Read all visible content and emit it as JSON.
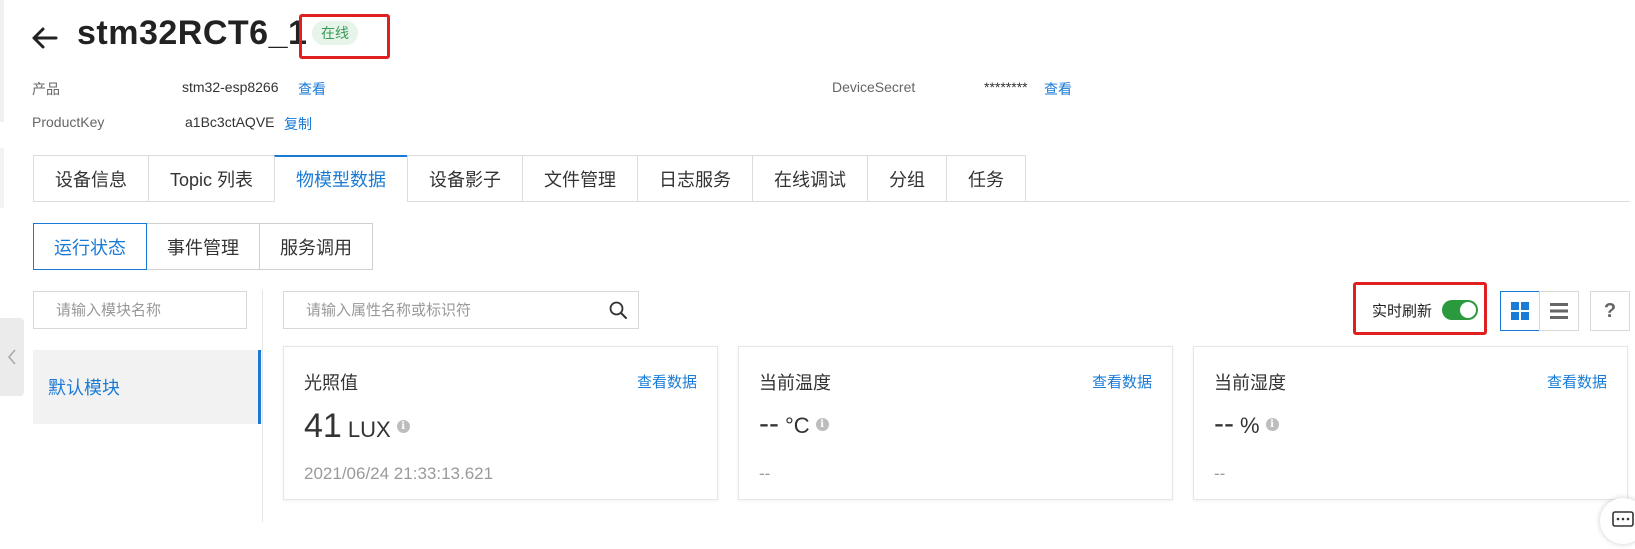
{
  "header": {
    "title": "stm32RCT6_1",
    "status": "在线"
  },
  "meta": {
    "product_label": "产品",
    "product_value": "stm32-esp8266",
    "product_link": "查看",
    "productkey_label": "ProductKey",
    "productkey_value": "a1Bc3ctAQVE",
    "productkey_link": "复制",
    "secret_label": "DeviceSecret",
    "secret_value": "********",
    "secret_link": "查看"
  },
  "main_tabs": [
    {
      "label": "设备信息"
    },
    {
      "label": "Topic 列表"
    },
    {
      "label": "物模型数据",
      "active": true
    },
    {
      "label": "设备影子"
    },
    {
      "label": "文件管理"
    },
    {
      "label": "日志服务"
    },
    {
      "label": "在线调试"
    },
    {
      "label": "分组"
    },
    {
      "label": "任务"
    }
  ],
  "sub_tabs": [
    {
      "label": "运行状态",
      "active": true
    },
    {
      "label": "事件管理"
    },
    {
      "label": "服务调用"
    }
  ],
  "sidebar": {
    "search_placeholder": "请输入模块名称",
    "modules": [
      {
        "label": "默认模块",
        "active": true
      }
    ]
  },
  "toolbar": {
    "search_placeholder": "请输入属性名称或标识符",
    "realtime_label": "实时刷新",
    "realtime_on": true,
    "view_mode": "grid",
    "help_label": "?"
  },
  "cards": [
    {
      "title": "光照值",
      "link": "查看数据",
      "value": "41",
      "unit": "LUX",
      "time": "2021/06/24 21:33:13.621"
    },
    {
      "title": "当前温度",
      "link": "查看数据",
      "value": "--",
      "unit": "°C",
      "time": "--"
    },
    {
      "title": "当前湿度",
      "link": "查看数据",
      "value": "--",
      "unit": "%",
      "time": "--"
    }
  ],
  "colors": {
    "accent": "#1a7bd6",
    "online_bg": "#e6f4ea",
    "online_text": "#3a9b57",
    "toggle_on": "#2b9a3e",
    "highlight_box": "#e02020"
  },
  "icons": [
    "back-arrow-icon",
    "search-icon",
    "info-icon",
    "grid-view-icon",
    "list-view-icon",
    "help-icon",
    "chevron-left-icon",
    "chat-icon"
  ]
}
